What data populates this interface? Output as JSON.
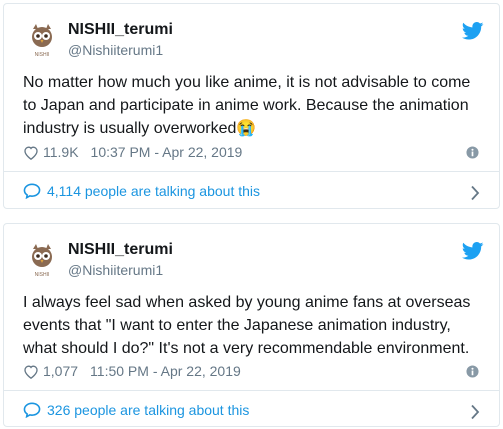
{
  "tweets": [
    {
      "display_name": "NISHII_terumi",
      "handle": "@Nishiiterumi1",
      "avatar_label": "NISHII",
      "text": "No matter how much you like anime, it is not advisable to come to Japan and participate in anime work.  Because the animation industry is usually overworked😭",
      "likes": "11.9K",
      "timestamp": "10:37 PM - Apr 22, 2019",
      "talking": "4,114 people are talking about this"
    },
    {
      "display_name": "NISHII_terumi",
      "handle": "@Nishiiterumi1",
      "avatar_label": "NISHII",
      "text": "I always feel sad when asked by young anime fans at overseas events that \"I want to enter the Japanese animation industry, what should I do?\"  It's not a very recommendable environment.",
      "likes": "1,077",
      "timestamp": "11:50 PM - Apr 22, 2019",
      "talking": "326 people are talking about this"
    }
  ],
  "colors": {
    "twitter_blue": "#1da1f2",
    "link_blue": "#1b95e0",
    "muted": "#657786",
    "border": "#e1e8ed"
  },
  "icons": {
    "brand": "twitter-bird-icon",
    "like": "heart-icon",
    "info": "info-icon",
    "reply": "speech-bubble-icon",
    "more": "chevron-right-icon"
  }
}
